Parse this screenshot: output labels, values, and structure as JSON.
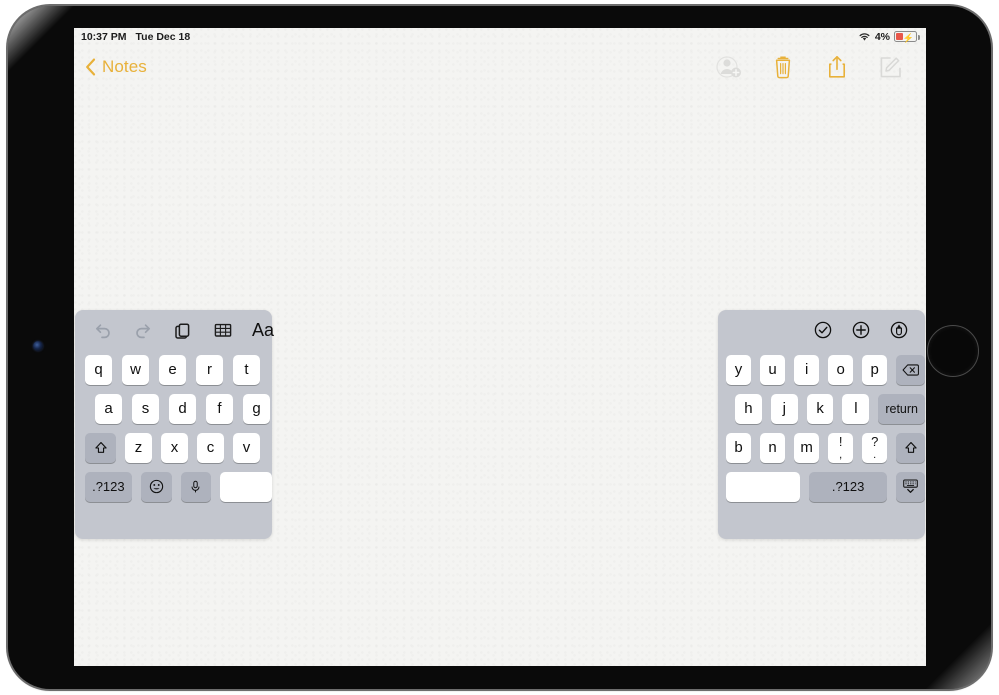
{
  "status_bar": {
    "time": "10:37 PM",
    "date": "Tue Dec 18",
    "wifi_icon": "wifi-icon",
    "battery_percent": "4%",
    "battery_icon": "battery-charging-icon"
  },
  "nav_bar": {
    "back_label": "Notes",
    "back_icon": "chevron-left-icon",
    "actions": [
      {
        "name": "add-person-button",
        "icon": "person-add-icon",
        "state": "disabled"
      },
      {
        "name": "delete-note-button",
        "icon": "trash-icon",
        "state": "enabled"
      },
      {
        "name": "share-note-button",
        "icon": "share-icon",
        "state": "enabled"
      },
      {
        "name": "compose-note-button",
        "icon": "compose-icon",
        "state": "disabled"
      }
    ]
  },
  "note": {
    "body_text": "",
    "placeholder": ""
  },
  "keyboard": {
    "mode": "split",
    "left": {
      "toolbar": [
        {
          "name": "undo-button",
          "icon": "undo-icon",
          "state": "disabled"
        },
        {
          "name": "redo-button",
          "icon": "redo-icon",
          "state": "disabled"
        },
        {
          "name": "paste-button",
          "icon": "clipboard-icon",
          "state": "enabled"
        },
        {
          "name": "table-button",
          "icon": "table-icon",
          "state": "enabled"
        },
        {
          "name": "format-button",
          "icon": "format-aa-icon",
          "label": "Aa",
          "state": "enabled"
        }
      ],
      "rows": [
        [
          {
            "label": "q"
          },
          {
            "label": "w"
          },
          {
            "label": "e"
          },
          {
            "label": "r"
          },
          {
            "label": "t"
          }
        ],
        [
          {
            "label": "a"
          },
          {
            "label": "s"
          },
          {
            "label": "d"
          },
          {
            "label": "f"
          },
          {
            "label": "g"
          }
        ],
        [
          {
            "label": "",
            "icon": "shift-icon",
            "dark": true
          },
          {
            "label": "z"
          },
          {
            "label": "x"
          },
          {
            "label": "c"
          },
          {
            "label": "v"
          }
        ],
        [
          {
            "label": ".?123",
            "dark": true
          },
          {
            "label": "",
            "icon": "emoji-icon",
            "dark": true
          },
          {
            "label": "",
            "icon": "microphone-icon",
            "dark": true
          },
          {
            "label": "",
            "icon": "space-key"
          }
        ]
      ]
    },
    "right": {
      "toolbar": [
        {
          "name": "checklist-button",
          "icon": "checkmark-circle-icon",
          "state": "enabled"
        },
        {
          "name": "attachment-button",
          "icon": "plus-circle-icon",
          "state": "enabled"
        },
        {
          "name": "markup-button",
          "icon": "markup-pen-circle-icon",
          "state": "enabled"
        }
      ],
      "rows": [
        [
          {
            "label": "y"
          },
          {
            "label": "u"
          },
          {
            "label": "i"
          },
          {
            "label": "o"
          },
          {
            "label": "p"
          },
          {
            "label": "",
            "icon": "backspace-icon",
            "dark": true
          }
        ],
        [
          {
            "label": "h"
          },
          {
            "label": "j"
          },
          {
            "label": "k"
          },
          {
            "label": "l"
          },
          {
            "label": "return",
            "dark": true
          }
        ],
        [
          {
            "label": "b"
          },
          {
            "label": "n"
          },
          {
            "label": "m"
          },
          {
            "label": "!",
            "sub": ","
          },
          {
            "label": "?",
            "sub": "."
          },
          {
            "label": "",
            "icon": "shift-icon",
            "dark": true
          }
        ],
        [
          {
            "label": "",
            "icon": "space-key"
          },
          {
            "label": ".?123",
            "dark": true
          },
          {
            "label": "",
            "icon": "hide-keyboard-icon",
            "dark": true
          }
        ]
      ]
    }
  },
  "colors": {
    "accent": "#e8b13a",
    "key_bg": "#ffffff",
    "key_dark_bg": "#aeb2bd",
    "keyboard_bg": "#c3c6ce",
    "screen_bg": "#f7f7f5",
    "battery_low": "#e8574a"
  }
}
